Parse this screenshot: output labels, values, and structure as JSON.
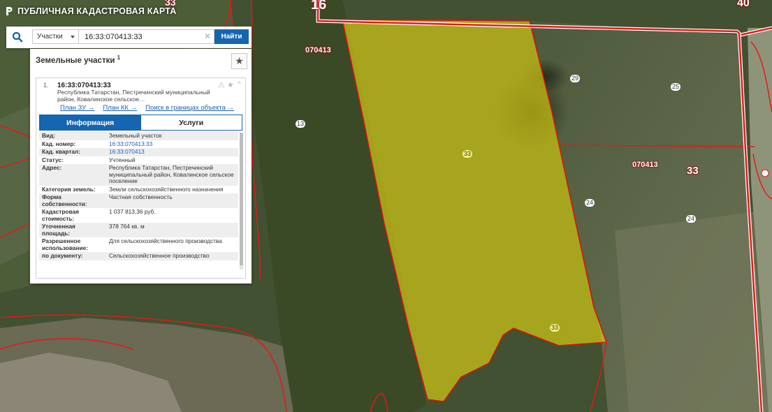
{
  "app": {
    "title": "ПУБЛИЧНАЯ КАДАСТРОВАЯ КАРТА"
  },
  "search": {
    "layer": "Участки",
    "query": "16:33:070413:33",
    "button": "Найти"
  },
  "panel": {
    "title": "Земельные участки",
    "count": "1",
    "result": {
      "index": "1.",
      "cadastral_number": "16:33:070413:33",
      "address": "Республика Татарстан, Пестречинский муниципальный район, Ковалинское сельское…",
      "links": [
        "План ЗУ →",
        "План КК →",
        "Поиск в границах объекта →"
      ]
    },
    "tabs": [
      "Информация",
      "Услуги"
    ],
    "attributes": [
      {
        "k": "Вид:",
        "v": "Земельный участок"
      },
      {
        "k": "Кад. номер:",
        "v": "16:33:070413:33"
      },
      {
        "k": "Кад. квартал:",
        "v": "16:33:070413"
      },
      {
        "k": "Статус:",
        "v": "Учтенный"
      },
      {
        "k": "Адрес:",
        "v": "Республика Татарстан, Пестречинский муниципальный район, Ковалинское сельское поселение"
      },
      {
        "k": "Категория земель:",
        "v": "Земли сельскохозяйственного назначения"
      },
      {
        "k": "Форма собственности:",
        "v": "Частная собственность"
      },
      {
        "k": "Кадастровая стоимость:",
        "v": "1 037 813,36 руб."
      },
      {
        "k": "Уточненная площадь:",
        "v": "378 764 кв. м"
      },
      {
        "k": "Разрешенное использование:",
        "v": "Для сельскохозяйственного производства"
      },
      {
        "k": "по документу:",
        "v": "Сельскохозяйственное производство"
      }
    ]
  },
  "map": {
    "labels": {
      "l16": "16",
      "l40": "40",
      "l33top": "33",
      "q1": "070413",
      "q2": "070413",
      "big33": "33",
      "n29": "29",
      "n25": "25",
      "n13": "13",
      "n33a": "33",
      "n24a": "24",
      "n24b": "24",
      "n33b": "33"
    },
    "colors": {
      "highlight": "#e6d814",
      "boundary": "#e11a1a",
      "button": "#1565b0"
    }
  },
  "icons": {
    "logo": "pkk-logo-icon",
    "search": "search-icon",
    "star": "star-icon",
    "warning": "warning-icon",
    "collapse": "chevron-up-icon",
    "clear": "clear-icon"
  }
}
